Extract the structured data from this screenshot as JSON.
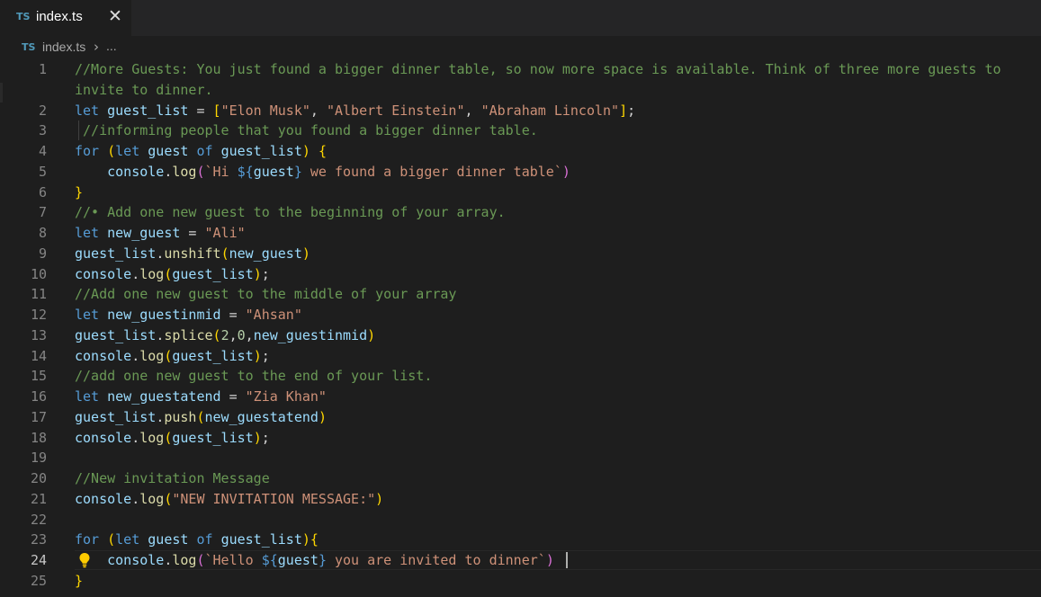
{
  "tab": {
    "badge": "TS",
    "filename": "index.ts",
    "close": "✕"
  },
  "breadcrumb": {
    "badge": "TS",
    "file": "index.ts",
    "separator": "›",
    "more": "..."
  },
  "editor": {
    "active_line": 24,
    "line_numbers": [
      "1",
      "2",
      "3",
      "4",
      "5",
      "6",
      "7",
      "8",
      "9",
      "10",
      "11",
      "12",
      "13",
      "14",
      "15",
      "16",
      "17",
      "18",
      "19",
      "20",
      "21",
      "22",
      "23",
      "24",
      "25"
    ],
    "lines": [
      {
        "num": "1",
        "tokens": [
          {
            "t": "//More Guests: You just found a bigger dinner table, so now more space is available. Think of three more guests to",
            "c": "cm"
          }
        ]
      },
      {
        "num": "",
        "tokens": [
          {
            "t": "invite to dinner.",
            "c": "cm"
          }
        ]
      },
      {
        "num": "2",
        "tokens": [
          {
            "t": "let",
            "c": "kw"
          },
          {
            "t": " ",
            "c": "pn"
          },
          {
            "t": "guest_list",
            "c": "vr"
          },
          {
            "t": " = ",
            "c": "pn"
          },
          {
            "t": "[",
            "c": "br1"
          },
          {
            "t": "\"Elon Musk\"",
            "c": "st"
          },
          {
            "t": ", ",
            "c": "pn"
          },
          {
            "t": "\"Albert Einstein\"",
            "c": "st"
          },
          {
            "t": ", ",
            "c": "pn"
          },
          {
            "t": "\"Abraham Lincoln\"",
            "c": "st"
          },
          {
            "t": "]",
            "c": "br1"
          },
          {
            "t": ";",
            "c": "pn"
          }
        ]
      },
      {
        "num": "3",
        "tokens": [
          {
            "t": " //informing people that you found a bigger dinner table.",
            "c": "cm"
          }
        ]
      },
      {
        "num": "4",
        "tokens": [
          {
            "t": "for",
            "c": "kw"
          },
          {
            "t": " ",
            "c": "pn"
          },
          {
            "t": "(",
            "c": "br1"
          },
          {
            "t": "let",
            "c": "kw"
          },
          {
            "t": " ",
            "c": "pn"
          },
          {
            "t": "guest",
            "c": "vr"
          },
          {
            "t": " ",
            "c": "pn"
          },
          {
            "t": "of",
            "c": "kw"
          },
          {
            "t": " ",
            "c": "pn"
          },
          {
            "t": "guest_list",
            "c": "vr"
          },
          {
            "t": ")",
            "c": "br1"
          },
          {
            "t": " ",
            "c": "pn"
          },
          {
            "t": "{",
            "c": "br1"
          }
        ]
      },
      {
        "num": "5",
        "tokens": [
          {
            "t": "    ",
            "c": "pn"
          },
          {
            "t": "console",
            "c": "vr"
          },
          {
            "t": ".",
            "c": "pn"
          },
          {
            "t": "log",
            "c": "fn"
          },
          {
            "t": "(",
            "c": "br2"
          },
          {
            "t": "`Hi ",
            "c": "st"
          },
          {
            "t": "${",
            "c": "kw"
          },
          {
            "t": "guest",
            "c": "vr"
          },
          {
            "t": "}",
            "c": "kw"
          },
          {
            "t": " we found a bigger dinner table`",
            "c": "st"
          },
          {
            "t": ")",
            "c": "br2"
          }
        ]
      },
      {
        "num": "6",
        "tokens": [
          {
            "t": "}",
            "c": "br1"
          }
        ]
      },
      {
        "num": "7",
        "tokens": [
          {
            "t": "//• Add one new guest to the beginning of your array.",
            "c": "cm"
          }
        ]
      },
      {
        "num": "8",
        "tokens": [
          {
            "t": "let",
            "c": "kw"
          },
          {
            "t": " ",
            "c": "pn"
          },
          {
            "t": "new_guest",
            "c": "vr"
          },
          {
            "t": " = ",
            "c": "pn"
          },
          {
            "t": "\"Ali\"",
            "c": "st"
          }
        ]
      },
      {
        "num": "9",
        "tokens": [
          {
            "t": "guest_list",
            "c": "vr"
          },
          {
            "t": ".",
            "c": "pn"
          },
          {
            "t": "unshift",
            "c": "fn"
          },
          {
            "t": "(",
            "c": "br1"
          },
          {
            "t": "new_guest",
            "c": "vr"
          },
          {
            "t": ")",
            "c": "br1"
          }
        ]
      },
      {
        "num": "10",
        "tokens": [
          {
            "t": "console",
            "c": "vr"
          },
          {
            "t": ".",
            "c": "pn"
          },
          {
            "t": "log",
            "c": "fn"
          },
          {
            "t": "(",
            "c": "br1"
          },
          {
            "t": "guest_list",
            "c": "vr"
          },
          {
            "t": ")",
            "c": "br1"
          },
          {
            "t": ";",
            "c": "pn"
          }
        ]
      },
      {
        "num": "11",
        "tokens": [
          {
            "t": "//Add one new guest to the middle of your array",
            "c": "cm"
          }
        ]
      },
      {
        "num": "12",
        "tokens": [
          {
            "t": "let",
            "c": "kw"
          },
          {
            "t": " ",
            "c": "pn"
          },
          {
            "t": "new_guestinmid",
            "c": "vr"
          },
          {
            "t": " = ",
            "c": "pn"
          },
          {
            "t": "\"Ahsan\"",
            "c": "st"
          }
        ]
      },
      {
        "num": "13",
        "tokens": [
          {
            "t": "guest_list",
            "c": "vr"
          },
          {
            "t": ".",
            "c": "pn"
          },
          {
            "t": "splice",
            "c": "fn"
          },
          {
            "t": "(",
            "c": "br1"
          },
          {
            "t": "2",
            "c": "nm"
          },
          {
            "t": ",",
            "c": "pn"
          },
          {
            "t": "0",
            "c": "nm"
          },
          {
            "t": ",",
            "c": "pn"
          },
          {
            "t": "new_guestinmid",
            "c": "vr"
          },
          {
            "t": ")",
            "c": "br1"
          }
        ]
      },
      {
        "num": "14",
        "tokens": [
          {
            "t": "console",
            "c": "vr"
          },
          {
            "t": ".",
            "c": "pn"
          },
          {
            "t": "log",
            "c": "fn"
          },
          {
            "t": "(",
            "c": "br1"
          },
          {
            "t": "guest_list",
            "c": "vr"
          },
          {
            "t": ")",
            "c": "br1"
          },
          {
            "t": ";",
            "c": "pn"
          }
        ]
      },
      {
        "num": "15",
        "tokens": [
          {
            "t": "//add one new guest to the end of your list.",
            "c": "cm"
          }
        ]
      },
      {
        "num": "16",
        "tokens": [
          {
            "t": "let",
            "c": "kw"
          },
          {
            "t": " ",
            "c": "pn"
          },
          {
            "t": "new_guestatend",
            "c": "vr"
          },
          {
            "t": " = ",
            "c": "pn"
          },
          {
            "t": "\"Zia Khan\"",
            "c": "st"
          }
        ]
      },
      {
        "num": "17",
        "tokens": [
          {
            "t": "guest_list",
            "c": "vr"
          },
          {
            "t": ".",
            "c": "pn"
          },
          {
            "t": "push",
            "c": "fn"
          },
          {
            "t": "(",
            "c": "br1"
          },
          {
            "t": "new_guestatend",
            "c": "vr"
          },
          {
            "t": ")",
            "c": "br1"
          }
        ]
      },
      {
        "num": "18",
        "tokens": [
          {
            "t": "console",
            "c": "vr"
          },
          {
            "t": ".",
            "c": "pn"
          },
          {
            "t": "log",
            "c": "fn"
          },
          {
            "t": "(",
            "c": "br1"
          },
          {
            "t": "guest_list",
            "c": "vr"
          },
          {
            "t": ")",
            "c": "br1"
          },
          {
            "t": ";",
            "c": "pn"
          }
        ]
      },
      {
        "num": "19",
        "tokens": []
      },
      {
        "num": "20",
        "tokens": [
          {
            "t": "//New invitation Message",
            "c": "cm"
          }
        ]
      },
      {
        "num": "21",
        "tokens": [
          {
            "t": "console",
            "c": "vr"
          },
          {
            "t": ".",
            "c": "pn"
          },
          {
            "t": "log",
            "c": "fn"
          },
          {
            "t": "(",
            "c": "br1"
          },
          {
            "t": "\"NEW INVITATION MESSAGE:\"",
            "c": "st"
          },
          {
            "t": ")",
            "c": "br1"
          }
        ]
      },
      {
        "num": "22",
        "tokens": []
      },
      {
        "num": "23",
        "tokens": [
          {
            "t": "for",
            "c": "kw"
          },
          {
            "t": " ",
            "c": "pn"
          },
          {
            "t": "(",
            "c": "br1"
          },
          {
            "t": "let",
            "c": "kw"
          },
          {
            "t": " ",
            "c": "pn"
          },
          {
            "t": "guest",
            "c": "vr"
          },
          {
            "t": " ",
            "c": "pn"
          },
          {
            "t": "of",
            "c": "kw"
          },
          {
            "t": " ",
            "c": "pn"
          },
          {
            "t": "guest_list",
            "c": "vr"
          },
          {
            "t": ")",
            "c": "br1"
          },
          {
            "t": "{",
            "c": "br1"
          }
        ]
      },
      {
        "num": "24",
        "tokens": [
          {
            "t": "    ",
            "c": "pn"
          },
          {
            "t": "console",
            "c": "vr"
          },
          {
            "t": ".",
            "c": "pn"
          },
          {
            "t": "log",
            "c": "fn"
          },
          {
            "t": "(",
            "c": "br2"
          },
          {
            "t": "`Hello ",
            "c": "st"
          },
          {
            "t": "${",
            "c": "kw"
          },
          {
            "t": "guest",
            "c": "vr"
          },
          {
            "t": "}",
            "c": "kw"
          },
          {
            "t": " you are invited to dinner`",
            "c": "st"
          },
          {
            "t": ")",
            "c": "br2"
          }
        ]
      },
      {
        "num": "25",
        "tokens": [
          {
            "t": "}",
            "c": "br1"
          }
        ]
      }
    ]
  },
  "icons": {
    "lightbulb": "lightbulb-icon",
    "ts_file": "typescript-file-icon",
    "close": "close-icon"
  },
  "colors": {
    "background": "#1e1e1e",
    "comment": "#6a9955",
    "keyword": "#569cd6",
    "string": "#ce9178",
    "variable": "#9cdcfe",
    "function": "#dcdcaa",
    "bracket": "#ffd700",
    "bracket_nested": "#da70d6",
    "lightbulb": "#ffcc00"
  }
}
